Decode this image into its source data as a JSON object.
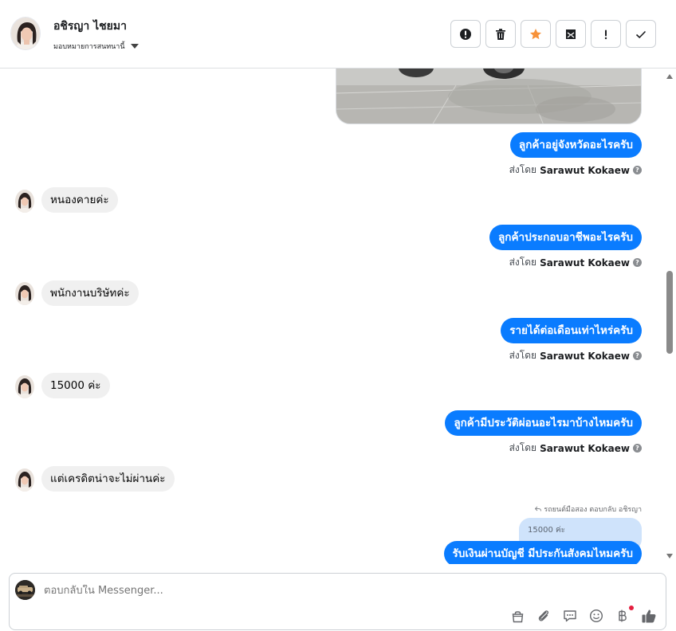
{
  "header": {
    "name": "อชิรญา ไชยมา",
    "assign_label": "มอบหมายการสนทนานี้",
    "toolbar": [
      {
        "name": "alert-circle-icon"
      },
      {
        "name": "trash-icon"
      },
      {
        "name": "star-icon",
        "color": "#f7923a"
      },
      {
        "name": "mark-unread-icon"
      },
      {
        "name": "exclamation-icon"
      },
      {
        "name": "check-icon"
      }
    ]
  },
  "messages": [
    {
      "dir": "out",
      "text": "ลูกค้าอยู่จังหวัดอะไรครับ",
      "sent_prefix": "ส่งโดย",
      "sent_by": "Sarawut Kokaew"
    },
    {
      "dir": "in",
      "text": "หนองคายค่ะ"
    },
    {
      "dir": "out",
      "text": "ลูกค้าประกอบอาชีพอะไรครับ",
      "sent_prefix": "ส่งโดย",
      "sent_by": "Sarawut Kokaew"
    },
    {
      "dir": "in",
      "text": "พนักงานบริษัทค่ะ"
    },
    {
      "dir": "out",
      "text": "รายได้ต่อเดือนเท่าไหร่ครับ",
      "sent_prefix": "ส่งโดย",
      "sent_by": "Sarawut Kokaew"
    },
    {
      "dir": "in",
      "text": "15000 ค่ะ"
    },
    {
      "dir": "out",
      "text": "ลูกค้ามีประวัติผ่อนอะไรมาบ้างไหมครับ",
      "sent_prefix": "ส่งโดย",
      "sent_by": "Sarawut Kokaew"
    },
    {
      "dir": "in",
      "text": "แต่เครดิตน่าจะไม่ผ่านค่ะ"
    }
  ],
  "reply": {
    "note": "รถยนต์มือสอง ตอบกลับ อชิรญา",
    "quoted": "15000 ค่ะ",
    "text": "รับเงินผ่านบัญชี มีประกันสังคมไหมครับ"
  },
  "composer": {
    "placeholder": "ตอบกลับใน Messenger...",
    "icons": [
      "shopping-bag-icon",
      "paperclip-icon",
      "saved-reply-icon",
      "emoji-icon",
      "baht-payment-icon",
      "thumbs-up-icon"
    ]
  },
  "colors": {
    "outgoing_bubble": "#0a7cff",
    "incoming_bubble": "#f0f0f0",
    "star": "#f7923a",
    "thumbs_up": "#0a7cff"
  }
}
